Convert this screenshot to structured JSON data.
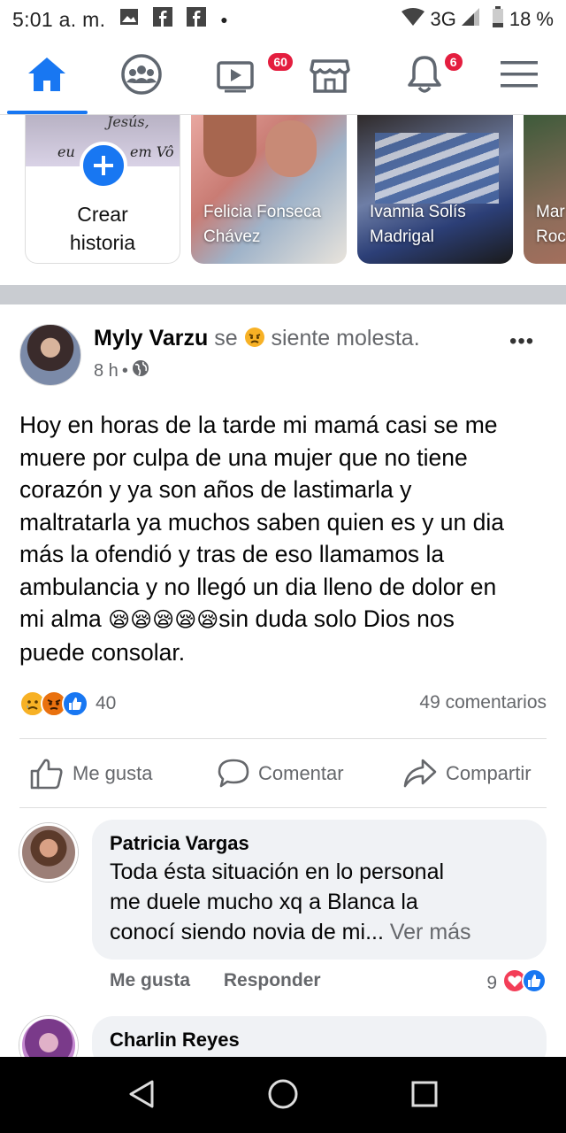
{
  "status": {
    "time": "5:01 a. m.",
    "network": "3G",
    "battery": "18 %"
  },
  "nav": {
    "video_badge": "60",
    "notifications_badge": "6"
  },
  "stories": {
    "create_label_1": "Crear",
    "create_label_2": "historia",
    "create_caption_1": "Jesús,",
    "create_caption_2": "eu",
    "create_caption_3": "em Vô",
    "items": [
      {
        "name_1": "Felicia Fonseca",
        "name_2": "Chávez"
      },
      {
        "name_1": "Ivannia Solís",
        "name_2": "Madrigal"
      },
      {
        "name_1": "Mar",
        "name_2": "Roc"
      }
    ]
  },
  "post": {
    "author": "Myly Varzu",
    "feeling_prefix": "se",
    "feeling": "siente molesta.",
    "time": "8 h",
    "more": "•••",
    "text_1": "Hoy en horas de la tarde mi mamá casi se me",
    "text_2": "muere por culpa de una mujer que no tiene",
    "text_3": "corazón y ya son años de lastimarla y",
    "text_4": "maltratarla ya muchos saben quien es y un dia",
    "text_5": "más la ofendió y tras de eso llamamos la",
    "text_6": "ambulancia y no llegó un dia lleno de dolor en",
    "text_7a": "mi alma ",
    "text_7_emoji": "😪😪😪😪😪",
    "text_7b": "sin duda solo Dios nos",
    "text_8": "puede consolar.",
    "reaction_count": "40",
    "comments_count": "49 comentarios",
    "like_label": "Me gusta",
    "comment_label": "Comentar",
    "share_label": "Compartir"
  },
  "comments": [
    {
      "name": "Patricia Vargas",
      "text_1": "Toda ésta situación en lo personal",
      "text_2": "me duele mucho xq a Blanca la",
      "text_3": "conocí siendo novia de mi...",
      "see_more": "Ver más",
      "like": "Me gusta",
      "reply": "Responder",
      "reactions": "9"
    },
    {
      "name": "Charlin Reyes"
    }
  ],
  "colors": {
    "accent": "#1877f2",
    "badge": "#e41e3f",
    "muted": "#65676b",
    "bubble": "#f0f2f5"
  }
}
